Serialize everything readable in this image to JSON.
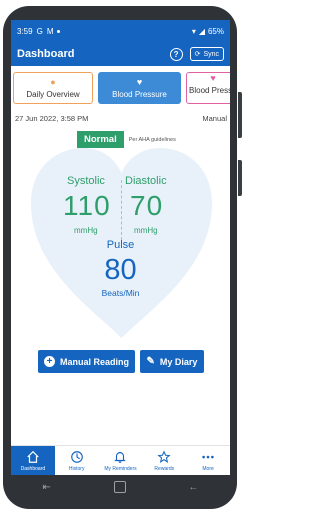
{
  "status_bar": {
    "time": "3:59",
    "left_icons": [
      "G",
      "M"
    ],
    "battery": "65%"
  },
  "app_bar": {
    "title": "Dashboard",
    "help_icon": "?",
    "sync_label": "Sync"
  },
  "tabs": [
    {
      "label": "Daily Overview",
      "icon": "person-icon",
      "active": false
    },
    {
      "label": "Blood Pressure",
      "icon": "heart-icon",
      "active": true
    },
    {
      "label": "Blood Pressu",
      "icon": "heart-icon",
      "active": false
    }
  ],
  "reading": {
    "datetime": "27 Jun 2022, 3:58 PM",
    "mode": "Manual",
    "status": "Normal",
    "guideline": "Per AHA guidelines",
    "systolic_label": "Systolic",
    "systolic_value": "110",
    "systolic_unit": "mmHg",
    "diastolic_label": "Diastolic",
    "diastolic_value": "70",
    "diastolic_unit": "mmHg",
    "pulse_label": "Pulse",
    "pulse_value": "80",
    "pulse_unit": "Beats/Min"
  },
  "actions": {
    "manual_reading": "Manual Reading",
    "my_diary": "My Diary"
  },
  "bottom_nav": [
    {
      "label": "Dashboard",
      "icon": "home-icon",
      "active": true
    },
    {
      "label": "History",
      "icon": "clock-icon",
      "active": false
    },
    {
      "label": "My Reminders",
      "icon": "bell-icon",
      "active": false
    },
    {
      "label": "Rewards",
      "icon": "star-icon",
      "active": false
    },
    {
      "label": "More",
      "icon": "more-icon",
      "active": false
    }
  ],
  "colors": {
    "primary": "#1565c0",
    "normal_green": "#2e9e6a",
    "heart_fill": "#e8f1fa"
  }
}
